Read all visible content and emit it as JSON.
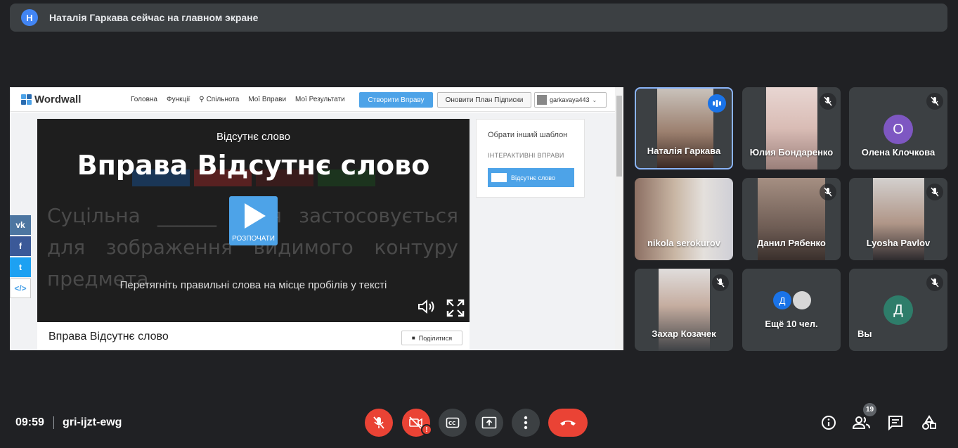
{
  "banner": {
    "avatar_letter": "Н",
    "text": "Наталія Гаркава сейчас на главном экране"
  },
  "wordwall": {
    "logo": "Wordwall",
    "nav": [
      "Головна",
      "Функції",
      "Спільнота",
      "Мої Вправи",
      "Мої Результати"
    ],
    "create_button": "Створити Вправу",
    "upgrade_button": "Оновити План Підписки",
    "username": "garkavaya443",
    "social": {
      "vk": "vk",
      "fb": "f",
      "tw": "t",
      "embed": "</>"
    },
    "player": {
      "subtitle": "Відсутнє слово",
      "title": "Вправа Відсутнє слово",
      "background_text": "Суцільна ______ лінія застосовується для зображення видимого контуру предмета",
      "start_label": "РОЗПОЧАТИ",
      "instruction": "Перетягніть правильні слова на місце пробілів у тексті"
    },
    "caption": {
      "title": "Вправа Відсутнє слово",
      "share": "Поділитися"
    },
    "side": {
      "choose_template": "Обрати інший шаблон",
      "section": "ІНТЕРАКТИВНІ ВПРАВИ",
      "template": "Відсутнє слово"
    }
  },
  "participants": [
    {
      "name": "Наталія Гаркава",
      "speaking": true
    },
    {
      "name": "Юлия Бондаренко",
      "muted": true
    },
    {
      "name": "Олена Клочкова",
      "initial": "О",
      "color": "#7e57c2",
      "muted": true
    },
    {
      "name": "nikola serokurov",
      "muted": false
    },
    {
      "name": "Данил Рябенко",
      "muted": true
    },
    {
      "name": "Lyosha Pavlov",
      "muted": true
    },
    {
      "name": "Захар Козачек",
      "muted": true
    },
    {
      "name": "Ещё 10 чел.",
      "initial": "Д",
      "color": "#1a73e8"
    },
    {
      "name": "Вы",
      "initial": "Д",
      "color": "#2e7d6a",
      "muted": true
    }
  ],
  "bottom": {
    "time": "09:59",
    "meeting_code": "gri-ijzt-ewg",
    "people_count": "19"
  },
  "colors": {
    "accent": "#4da3e8",
    "danger": "#ea4335",
    "tile": "#3c4043"
  }
}
